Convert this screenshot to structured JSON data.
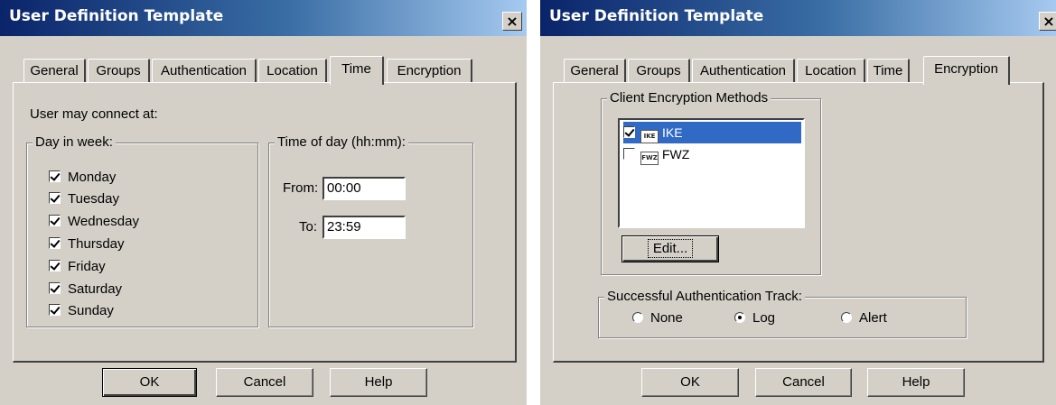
{
  "dialog_left": {
    "title": "User Definition Template",
    "close_label": "×",
    "tabs": [
      {
        "label": "General"
      },
      {
        "label": "Groups"
      },
      {
        "label": "Authentication"
      },
      {
        "label": "Location"
      },
      {
        "label": "Time",
        "active": true
      },
      {
        "label": "Encryption"
      }
    ],
    "connect_label": "User may connect at:",
    "days_group": {
      "legend": "Day in week:",
      "days": [
        {
          "label": "Monday",
          "checked": true
        },
        {
          "label": "Tuesday",
          "checked": true
        },
        {
          "label": "Wednesday",
          "checked": true
        },
        {
          "label": "Thursday",
          "checked": true
        },
        {
          "label": "Friday",
          "checked": true
        },
        {
          "label": "Saturday",
          "checked": true
        },
        {
          "label": "Sunday",
          "checked": true
        }
      ]
    },
    "time_group": {
      "legend": "Time of day (hh:mm):",
      "from_label": "From:",
      "from_value": "00:00",
      "to_label": "To:",
      "to_value": "23:59"
    },
    "buttons": {
      "ok": "OK",
      "cancel": "Cancel",
      "help": "Help"
    }
  },
  "dialog_right": {
    "title": "User Definition Template",
    "close_label": "×",
    "tabs": [
      {
        "label": "General"
      },
      {
        "label": "Groups"
      },
      {
        "label": "Authentication"
      },
      {
        "label": "Location"
      },
      {
        "label": "Time"
      },
      {
        "label": "Encryption",
        "active": true
      }
    ],
    "methods_group": {
      "legend": "Client Encryption Methods",
      "items": [
        {
          "label": "IKE",
          "icon": "IKE",
          "checked": true,
          "selected": true
        },
        {
          "label": "FWZ",
          "icon": "FWZ",
          "checked": false,
          "selected": false
        }
      ],
      "edit_label": "Edit..."
    },
    "track_group": {
      "legend": "Successful Authentication Track:",
      "options": [
        {
          "label": "None",
          "checked": false
        },
        {
          "label": "Log",
          "checked": true
        },
        {
          "label": "Alert",
          "checked": false
        }
      ]
    },
    "buttons": {
      "ok": "OK",
      "cancel": "Cancel",
      "help": "Help"
    }
  },
  "colors": {
    "title_bar_start": "#0a246a",
    "title_bar_end": "#a6caf0",
    "dialog_face": "#d4d0c8",
    "selection": "#316ac5"
  }
}
